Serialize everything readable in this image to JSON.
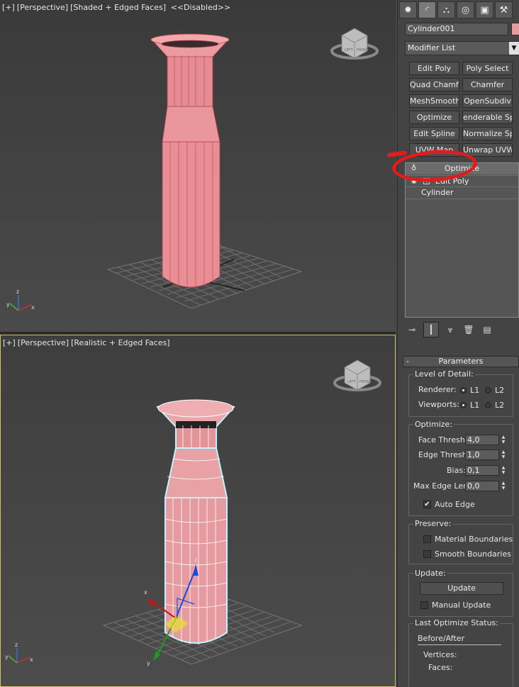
{
  "viewport_top": {
    "label_plus": "[+]",
    "label_view": "[Perspective]",
    "label_shading": "[Shaded + Edged Faces]",
    "label_extra": "<<Disabled>>",
    "viewcube_left": "LEFT",
    "viewcube_front": "FRONT",
    "axis_z": "z",
    "axis_y": "y",
    "axis_x": "x"
  },
  "viewport_bottom": {
    "label_plus": "[+]",
    "label_view": "[Perspective]",
    "label_shading": "[Realistic + Edged Faces]",
    "viewcube_left": "LEFT",
    "viewcube_front": "FRONT",
    "gizmo_z": "z",
    "gizmo_x": "x",
    "gizmo_y": "y",
    "axis_z": "z",
    "axis_y": "y",
    "axis_x": "x"
  },
  "panel": {
    "tabs": [
      {
        "icon": "create-icon",
        "glyph": "✹"
      },
      {
        "icon": "modify-icon",
        "glyph": "◜"
      },
      {
        "icon": "hierarchy-icon",
        "glyph": "⛬"
      },
      {
        "icon": "motion-icon",
        "glyph": "◎"
      },
      {
        "icon": "display-icon",
        "glyph": "▣"
      },
      {
        "icon": "utilities-icon",
        "glyph": "⚒"
      }
    ],
    "object_name": "Cylinder001",
    "object_color": "#e99a9a",
    "modifier_list": "Modifier List",
    "modifier_buttons": [
      "Edit Poly",
      "Poly Select",
      "Quad Chamfer",
      "Chamfer",
      "MeshSmooth",
      "OpenSubdiv",
      "Optimize",
      "enderable Splin",
      "Edit Spline",
      "Normalize Spl.",
      "UVW Map",
      "Unwrap UVW"
    ],
    "stack": {
      "items": [
        "Optimize",
        "Edit Poly",
        "Cylinder"
      ]
    },
    "annotation_color": "#e21b1b",
    "parameters": {
      "title": "Parameters",
      "collapse": "-",
      "lod_title": "Level of Detail:",
      "renderer_label": "Renderer:",
      "viewports_label": "Viewports:",
      "l1": "L1",
      "l2": "L2",
      "optimize_title": "Optimize:",
      "face_thresh_label": "Face Thresh:",
      "face_thresh": "4,0",
      "edge_thresh_label": "Edge Thresh:",
      "edge_thresh": "1,0",
      "bias_label": "Bias:",
      "bias": "0,1",
      "max_edge_len_label": "Max Edge Len:",
      "max_edge_len": "0,0",
      "auto_edge_label": "Auto Edge",
      "auto_edge_checked": true,
      "preserve_title": "Preserve:",
      "material_boundaries_label": "Material Boundaries",
      "smooth_boundaries_label": "Smooth Boundaries",
      "update_title": "Update:",
      "update_button": "Update",
      "manual_update_label": "Manual Update",
      "status_title": "Last Optimize Status:",
      "before_after": "Before/After",
      "vertices_label": "Vertices:",
      "faces_label": "Faces:"
    }
  }
}
